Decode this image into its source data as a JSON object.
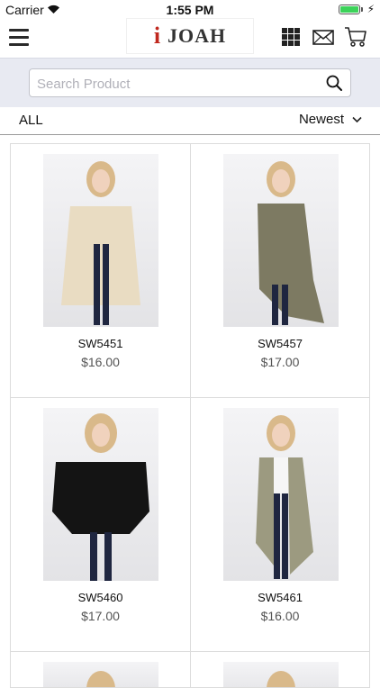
{
  "status_bar": {
    "carrier": "Carrier",
    "time": "1:55 PM",
    "battery_color": "#3cd35a"
  },
  "header": {
    "logo_mark": "i",
    "logo_word": "JOAH",
    "icons": [
      "menu-icon",
      "grid-view-icon",
      "mail-icon",
      "cart-icon"
    ]
  },
  "search": {
    "placeholder": "Search Product",
    "value": ""
  },
  "filter": {
    "category": "ALL",
    "sort": "Newest"
  },
  "products": [
    {
      "sku": "SW5451",
      "price": "$16.00",
      "garment_color": "#e9dcc2"
    },
    {
      "sku": "SW5457",
      "price": "$17.00",
      "garment_color": "#7d7a62"
    },
    {
      "sku": "SW5460",
      "price": "$17.00",
      "garment_color": "#141414"
    },
    {
      "sku": "SW5461",
      "price": "$16.00",
      "garment_color": "#9c9a80"
    }
  ]
}
